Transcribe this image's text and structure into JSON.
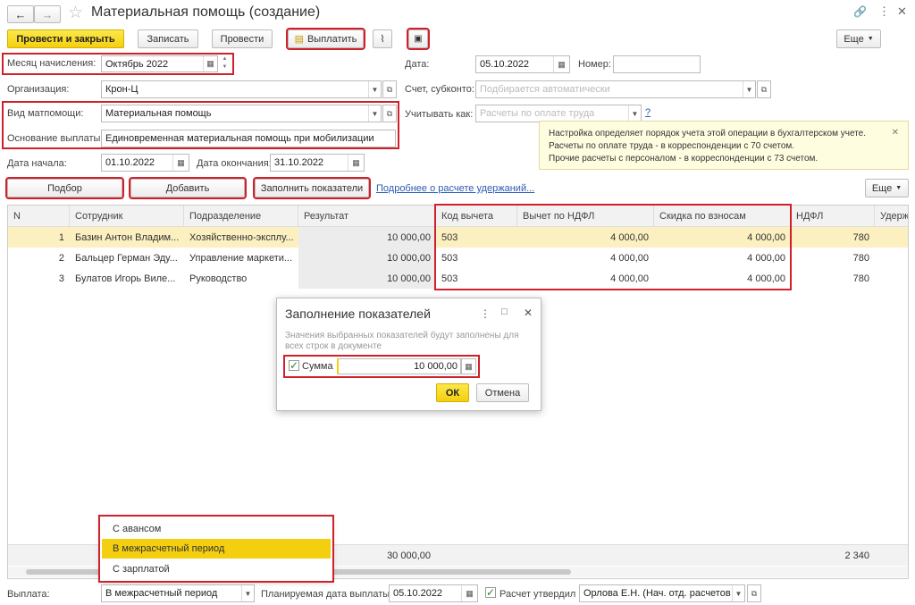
{
  "window": {
    "title": "Материальная помощь (создание)"
  },
  "toolbar": {
    "post_close": "Провести и закрыть",
    "save": "Записать",
    "post": "Провести",
    "pay": "Выплатить",
    "more": "Еще"
  },
  "form": {
    "month_label": "Месяц начисления:",
    "month_value": "Октябрь 2022",
    "date_label": "Дата:",
    "date_value": "05.10.2022",
    "number_label": "Номер:",
    "number_value": "",
    "org_label": "Организация:",
    "org_value": "Крон-Ц",
    "account_label": "Счет, субконто:",
    "account_placeholder": "Подбирается автоматически",
    "kind_label": "Вид матпомощи:",
    "kind_value": "Материальная помощь",
    "consider_label": "Учитывать как:",
    "consider_placeholder": "Расчеты по оплате труда",
    "help": "?",
    "basis_label": "Основание выплаты:",
    "basis_value": "Единовременная материальная помощь при мобилизации",
    "start_label": "Дата начала:",
    "start_value": "01.10.2022",
    "end_label": "Дата окончания:",
    "end_value": "31.10.2022"
  },
  "tooltip": {
    "text1": "Настройка определяет порядок учета этой операции в бухгалтерском учете.",
    "text2": "Расчеты по оплате труда - в корреспонденции с 70 счетом.",
    "text3": "Прочие расчеты с персоналом - в корреспонденции с 73 счетом."
  },
  "table_toolbar": {
    "pick": "Подбор",
    "add": "Добавить",
    "fill": "Заполнить показатели",
    "link": "Подробнее о расчете удержаний...",
    "more": "Еще"
  },
  "table": {
    "columns": [
      "N",
      "Сотрудник",
      "Подразделение",
      "Результат",
      "Код вычета",
      "Вычет по НДФЛ",
      "Скидка по взносам",
      "НДФЛ",
      "Удерж"
    ],
    "rows": [
      {
        "n": "1",
        "emp": "Базин Антон Владим...",
        "dep": "Хозяйственно-эксплу...",
        "res": "10 000,00",
        "code": "503",
        "ded": "4 000,00",
        "disc": "4 000,00",
        "ndfl": "780"
      },
      {
        "n": "2",
        "emp": "Бальцер Герман Эду...",
        "dep": "Управление маркети...",
        "res": "10 000,00",
        "code": "503",
        "ded": "4 000,00",
        "disc": "4 000,00",
        "ndfl": "780"
      },
      {
        "n": "3",
        "emp": "Булатов Игорь Виле...",
        "dep": "Руководство",
        "res": "10 000,00",
        "code": "503",
        "ded": "4 000,00",
        "disc": "4 000,00",
        "ndfl": "780"
      }
    ],
    "total_res": "30 000,00",
    "total_ndfl": "2 340"
  },
  "dialog": {
    "title": "Заполнение показателей",
    "desc1": "Значения выбранных показателей будут заполнены для",
    "desc2": "всех строк в документе",
    "sum_label": "Сумма",
    "sum_value": "10 000,00",
    "checked": true,
    "ok": "ОК",
    "cancel": "Отмена"
  },
  "dropdown": {
    "options": [
      "С авансом",
      "В межрасчетный период",
      "С зарплатой"
    ],
    "selected": 1
  },
  "footer": {
    "payout_label": "Выплата:",
    "payout_value": "В межрасчетный период",
    "plan_label": "Планируемая дата выплаты:",
    "plan_value": "05.10.2022",
    "approved_label": "Расчет утвердил",
    "approved_value": "Орлова Е.Н. (Нач. отд. расчетов г"
  },
  "colors": {
    "accent": "#f4cf10",
    "highlight": "#d0202a",
    "selected_row": "#fcefc0",
    "tooltip_bg": "#fffde0"
  }
}
